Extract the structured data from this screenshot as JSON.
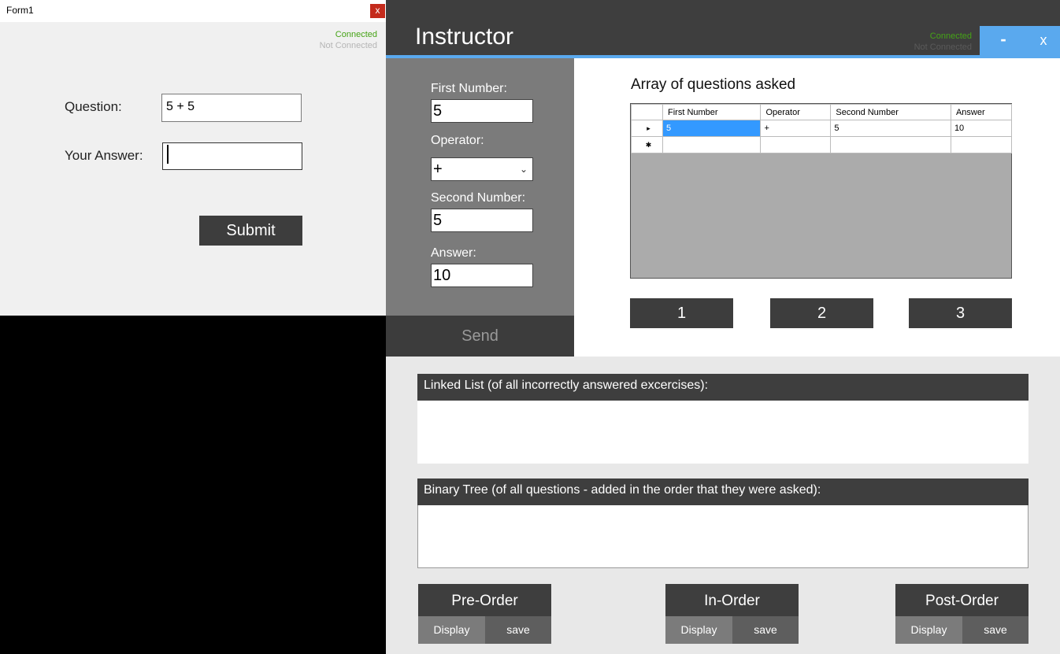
{
  "student_form": {
    "title": "Form1",
    "close_label": "x",
    "status_connected": "Connected",
    "status_not_connected": "Not Connected",
    "question_label": "Question:",
    "question_value": "5 + 5",
    "answer_label": "Your Answer:",
    "answer_value": "",
    "submit_label": "Submit"
  },
  "instructor": {
    "title": "Instructor",
    "status_connected": "Connected",
    "status_not_connected": "Not Connected",
    "minimize_label": "-",
    "close_label": "x",
    "first_number_label": "First Number:",
    "first_number_value": "5",
    "operator_label": "Operator:",
    "operator_value": "+",
    "second_number_label": "Second Number:",
    "second_number_value": "5",
    "answer_label": "Answer:",
    "answer_value": "10",
    "send_label": "Send",
    "array_title": "Array of questions asked",
    "grid": {
      "columns": [
        "First Number",
        "Operator",
        "Second Number",
        "Answer"
      ],
      "rows": [
        [
          "5",
          "+",
          "5",
          "10"
        ]
      ]
    },
    "sort_buttons": [
      "1",
      "2",
      "3"
    ],
    "linked_list_header": "Linked List  (of all incorrectly answered excercises):",
    "binary_tree_header": "Binary Tree  (of all questions -  added in the order that they were asked):",
    "traversals": [
      {
        "label": "Pre-Order",
        "display": "Display",
        "save": "save"
      },
      {
        "label": "In-Order",
        "display": "Display",
        "save": "save"
      },
      {
        "label": "Post-Order",
        "display": "Display",
        "save": "save"
      }
    ],
    "colors": {
      "accent": "#5aa9ee",
      "dark": "#3e3e3e",
      "connected": "#45a316"
    }
  }
}
